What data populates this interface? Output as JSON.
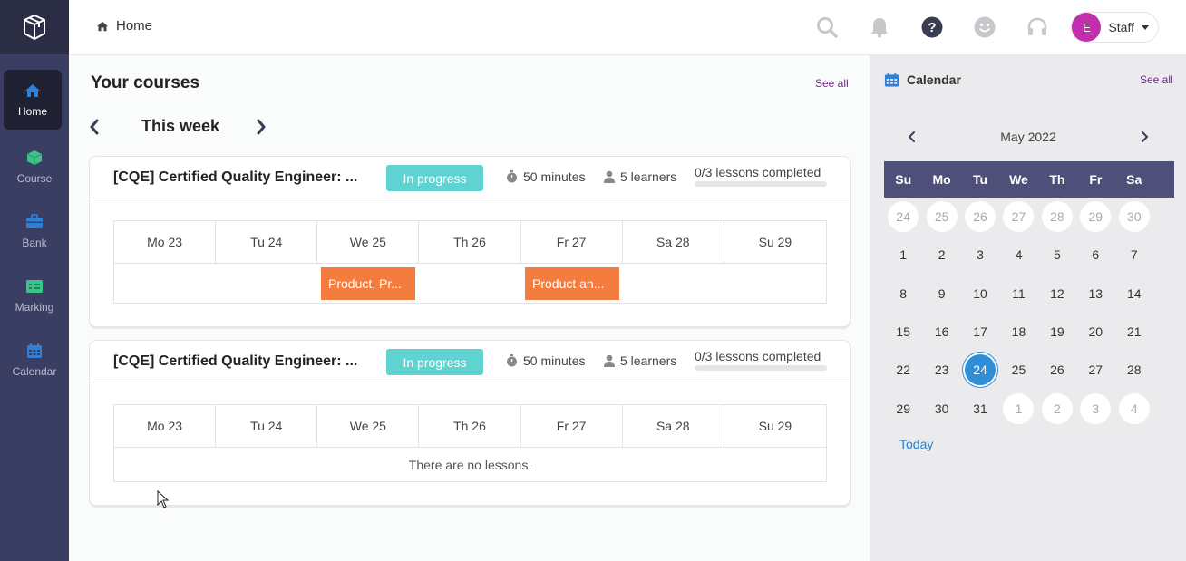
{
  "sidebar": {
    "logo": "box-logo-icon",
    "items": [
      {
        "label": "Home",
        "icon": "home-icon",
        "color": "#2f7fd6"
      },
      {
        "label": "Course",
        "icon": "cube-icon",
        "color": "#3bc38a"
      },
      {
        "label": "Bank",
        "icon": "briefcase-icon",
        "color": "#2f7fd6"
      },
      {
        "label": "Marking",
        "icon": "marking-icon",
        "color": "#3bc38a"
      },
      {
        "label": "Calendar",
        "icon": "calendar-icon",
        "color": "#2f7fd6"
      }
    ]
  },
  "header": {
    "breadcrumb": "Home",
    "icons": [
      "search-icon",
      "bell-icon",
      "help-icon",
      "smiley-icon",
      "headset-icon"
    ],
    "user": {
      "initial": "E",
      "name": "Staff"
    }
  },
  "courses": {
    "title": "Your courses",
    "see_all": "See all",
    "week_label": "This week",
    "days": [
      "Mo 23",
      "Tu 24",
      "We 25",
      "Th 26",
      "Fr 27",
      "Sa 28",
      "Su 29"
    ],
    "cards": [
      {
        "title": "[CQE] Certified Quality Engineer: ...",
        "status": "In progress",
        "duration": "50 minutes",
        "learners": "5 learners",
        "progress_text": "0/3 lessons completed",
        "progress": 0,
        "lessons": [
          {
            "label": "Product, Pr...",
            "day_index": 2
          },
          {
            "label": "Product an...",
            "day_index": 4
          }
        ],
        "empty": ""
      },
      {
        "title": "[CQE] Certified Quality Engineer: ...",
        "status": "In progress",
        "duration": "50 minutes",
        "learners": "5 learners",
        "progress_text": "0/3 lessons completed",
        "progress": 0,
        "lessons": [],
        "empty": "There are no lessons."
      }
    ]
  },
  "calendar": {
    "title": "Calendar",
    "see_all": "See all",
    "month": "May 2022",
    "dow": [
      "Su",
      "Mo",
      "Tu",
      "We",
      "Th",
      "Fr",
      "Sa"
    ],
    "weeks": [
      [
        "24",
        "25",
        "26",
        "27",
        "28",
        "29",
        "30"
      ],
      [
        "1",
        "2",
        "3",
        "4",
        "5",
        "6",
        "7"
      ],
      [
        "8",
        "9",
        "10",
        "11",
        "12",
        "13",
        "14"
      ],
      [
        "15",
        "16",
        "17",
        "18",
        "19",
        "20",
        "21"
      ],
      [
        "22",
        "23",
        "24",
        "25",
        "26",
        "27",
        "28"
      ],
      [
        "29",
        "30",
        "31",
        "1",
        "2",
        "3",
        "4"
      ]
    ],
    "today_label": "Today",
    "today_date": "24"
  },
  "colors": {
    "sidebar": "#3b3e63",
    "accent_teal": "#5fd3d2",
    "lesson_orange": "#f47c3f",
    "today_blue": "#2f8fd6",
    "link_purple": "#6a2b7e"
  }
}
